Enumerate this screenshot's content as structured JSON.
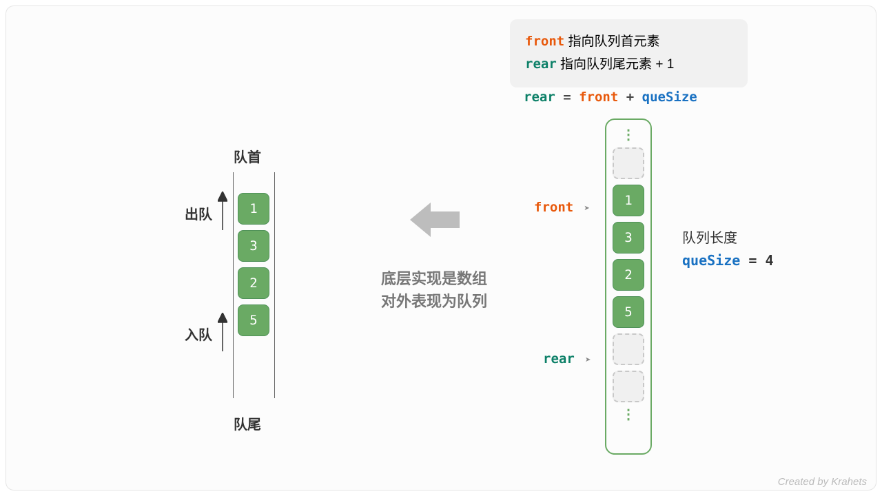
{
  "info_box": {
    "front_word": "front",
    "front_desc": " 指向队列首元素",
    "rear_word": "rear",
    "rear_desc": " 指向队列尾元素 + 1"
  },
  "formula": {
    "rear": "rear",
    "eq": " = ",
    "front": "front",
    "plus": " + ",
    "qs": "queSize"
  },
  "left_queue": {
    "head": "队首",
    "tail": "队尾",
    "dequeue": "出队",
    "enqueue": "入队",
    "values": [
      "1",
      "3",
      "2",
      "5"
    ]
  },
  "center": {
    "line1": "底层实现是数组",
    "line2": "对外表现为队列"
  },
  "right_array": {
    "front_label": "front",
    "rear_label": "rear",
    "pointer_glyph": "➤",
    "values": [
      "1",
      "3",
      "2",
      "5"
    ]
  },
  "qlen": {
    "label": "队列长度",
    "var": "queSize",
    "eq": " = ",
    "val": "4"
  },
  "credit": "Created by Krahets"
}
